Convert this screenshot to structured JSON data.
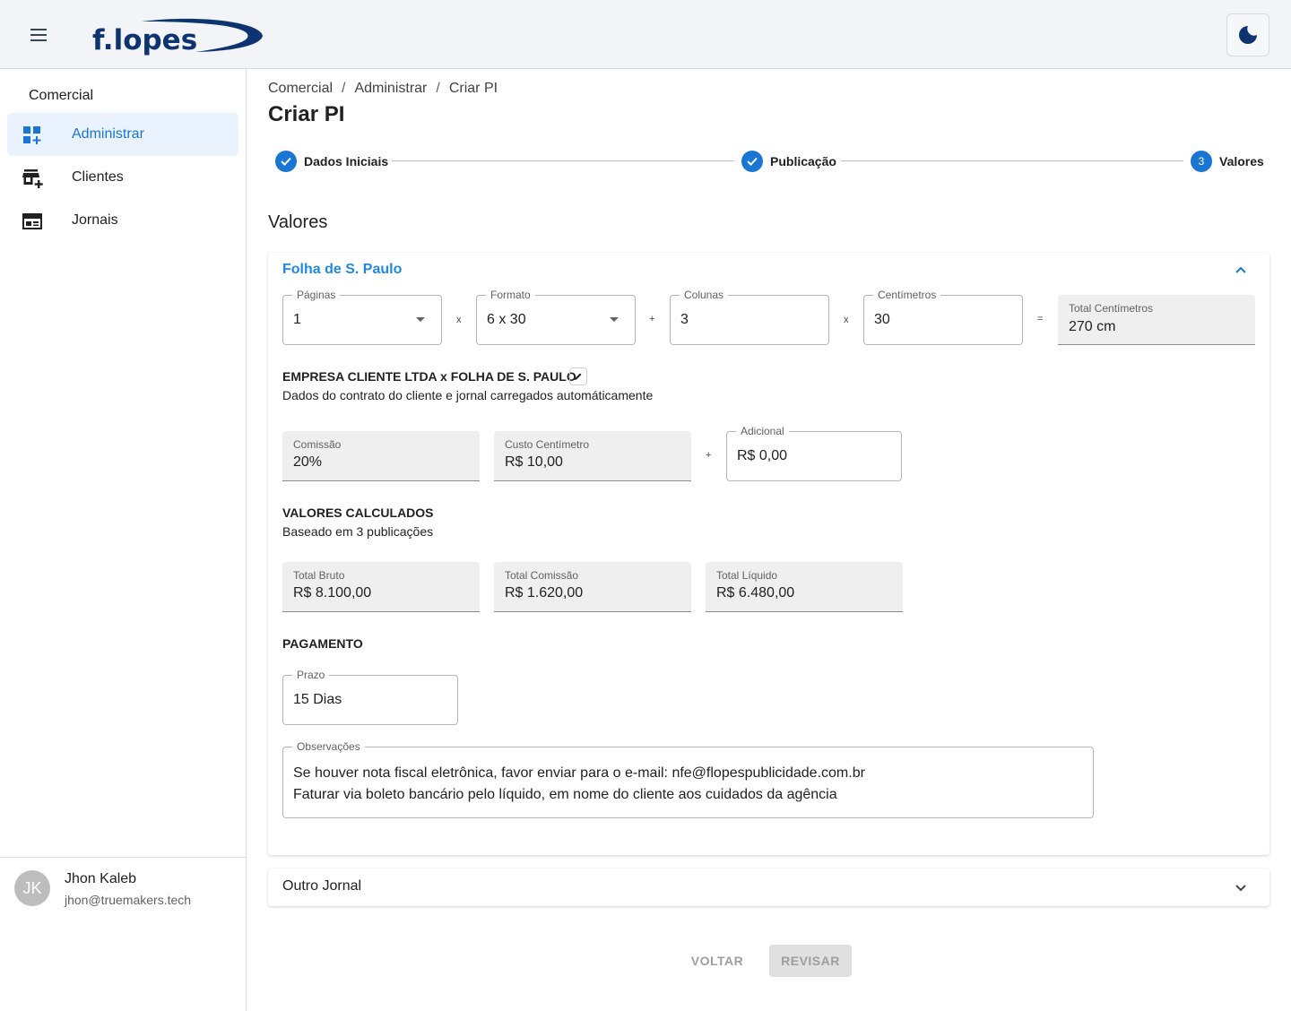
{
  "header": {
    "logo_text": "f.lopes",
    "menu_icon": "hamburger-menu-icon",
    "theme_icon": "moon-icon"
  },
  "sidebar": {
    "heading": "Comercial",
    "items": [
      {
        "label": "Administrar",
        "icon": "dashboard-add-icon",
        "active": true
      },
      {
        "label": "Clientes",
        "icon": "add-business-icon",
        "active": false
      },
      {
        "label": "Jornais",
        "icon": "newspaper-icon",
        "active": false
      }
    ],
    "user": {
      "initials": "JK",
      "name": "Jhon Kaleb",
      "email": "jhon@truemakers.tech"
    }
  },
  "breadcrumb": [
    "Comercial",
    "Administrar",
    "Criar PI"
  ],
  "page_title": "Criar PI",
  "stepper": {
    "steps": [
      {
        "label": "Dados Iniciais",
        "state": "completed"
      },
      {
        "label": "Publicação",
        "state": "completed"
      },
      {
        "label": "Valores",
        "state": "active",
        "number": "3"
      }
    ]
  },
  "section_title": "Valores",
  "newspaper_card": {
    "title": "Folha de S. Paulo",
    "paginas": {
      "label": "Páginas",
      "value": "1"
    },
    "formato": {
      "label": "Formato",
      "value": "6 x 30"
    },
    "colunas": {
      "label": "Colunas",
      "value": "3"
    },
    "centimetros": {
      "label": "Centímetros",
      "value": "30"
    },
    "total_centimetros": {
      "label": "Total Centímetros",
      "value": "270 cm"
    },
    "ops": {
      "times": "x",
      "plus": "+",
      "equals": "="
    },
    "contract": {
      "title": "EMPRESA CLIENTE LTDA x FOLHA DE S. PAULO",
      "subtitle": "Dados do contrato do cliente e jornal carregados automáticamente"
    },
    "comissao": {
      "label": "Comissão",
      "value": "20%"
    },
    "custo_centimetro": {
      "label": "Custo Centímetro",
      "value": "R$ 10,00"
    },
    "adicional": {
      "label": "Adicional",
      "value": "R$ 0,00"
    },
    "calculated": {
      "title": "VALORES CALCULADOS",
      "subtitle": "Baseado em 3 publicações",
      "total_bruto": {
        "label": "Total Bruto",
        "value": "R$ 8.100,00"
      },
      "total_comissao": {
        "label": "Total Comissão",
        "value": "R$ 1.620,00"
      },
      "total_liquido": {
        "label": "Total Líquido",
        "value": "R$ 6.480,00"
      }
    },
    "payment": {
      "title": "PAGAMENTO",
      "prazo": {
        "label": "Prazo",
        "value": "15 Dias"
      },
      "observacoes": {
        "label": "Observações",
        "line1": "Se houver nota fiscal eletrônica, favor enviar para o e-mail: nfe@flopespublicidade.com.br",
        "line2": "Faturar via boleto bancário pelo líquido, em nome do cliente aos cuidados da agência"
      }
    }
  },
  "other_card": {
    "title": "Outro Jornal"
  },
  "actions": {
    "back_label": "VOLTAR",
    "review_label": "REVISAR"
  },
  "colors": {
    "primary": "#1976d2",
    "link_title": "#1e88e5",
    "active_bg": "#e9f2fd",
    "logo": "#0d3470"
  }
}
